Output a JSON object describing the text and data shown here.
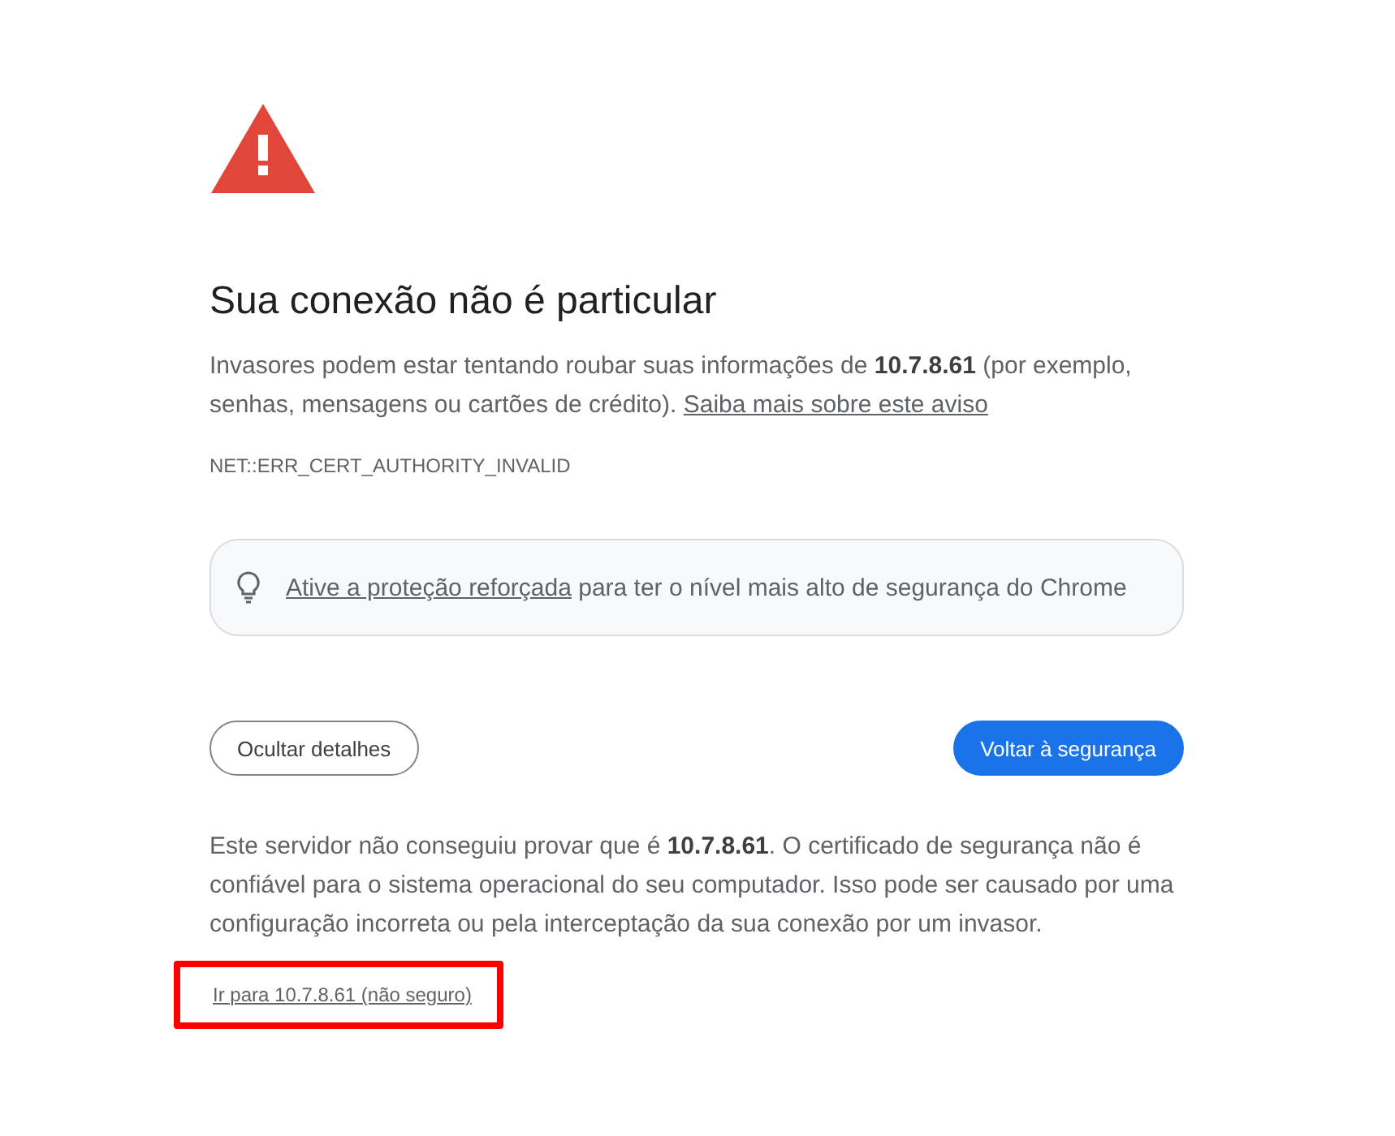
{
  "heading": "Sua conexão não é particular",
  "intro": {
    "text": "Invasores podem estar tentando roubar suas informações de **10.7.8.61** (por exemplo, senhas, mensagens ou cartões de crédito).",
    "link": "Saiba mais sobre este aviso"
  },
  "error_code": "NET::ERR_CERT_AUTHORITY_INVALID",
  "tip": {
    "link": "Ative a proteção reforçada",
    "text": "para ter o nível mais alto de segurança do Chrome"
  },
  "buttons": [
    {
      "label": "Ocultar detalhes",
      "kind": "secondary"
    },
    {
      "label": "Voltar à segurança",
      "kind": "primary"
    }
  ],
  "details": "Este servidor não conseguiu provar que é **10.7.8.61**. O certificado de segurança não é confiável para o sistema operacional do seu computador. Isso pode ser causado por uma configuração incorreta ou pela interceptação da sua conexão por um invasor.",
  "proceed_link": {
    "label": "Ir para 10.7.8.61 (não seguro)",
    "highlighted": true
  }
}
